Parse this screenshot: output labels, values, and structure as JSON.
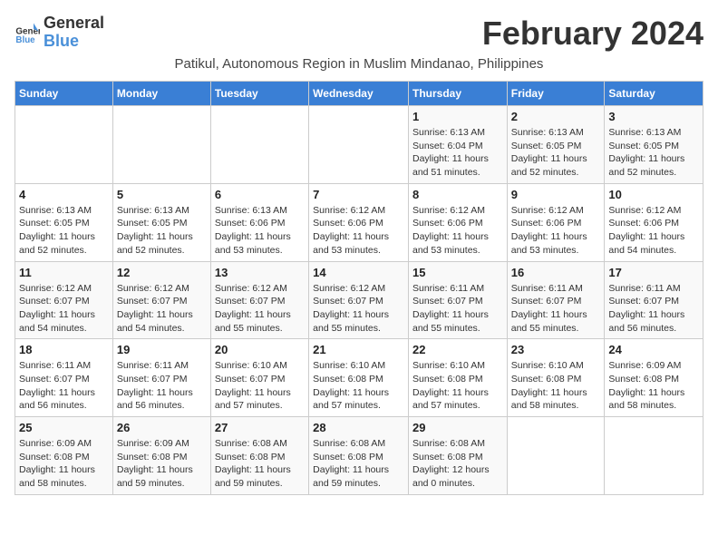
{
  "header": {
    "logo_general": "General",
    "logo_blue": "Blue",
    "month_title": "February 2024",
    "subtitle": "Patikul, Autonomous Region in Muslim Mindanao, Philippines"
  },
  "days_of_week": [
    "Sunday",
    "Monday",
    "Tuesday",
    "Wednesday",
    "Thursday",
    "Friday",
    "Saturday"
  ],
  "weeks": [
    [
      {
        "day": "",
        "sunrise": "",
        "sunset": "",
        "daylight": ""
      },
      {
        "day": "",
        "sunrise": "",
        "sunset": "",
        "daylight": ""
      },
      {
        "day": "",
        "sunrise": "",
        "sunset": "",
        "daylight": ""
      },
      {
        "day": "",
        "sunrise": "",
        "sunset": "",
        "daylight": ""
      },
      {
        "day": "1",
        "sunrise": "Sunrise: 6:13 AM",
        "sunset": "Sunset: 6:04 PM",
        "daylight": "Daylight: 11 hours and 51 minutes."
      },
      {
        "day": "2",
        "sunrise": "Sunrise: 6:13 AM",
        "sunset": "Sunset: 6:05 PM",
        "daylight": "Daylight: 11 hours and 52 minutes."
      },
      {
        "day": "3",
        "sunrise": "Sunrise: 6:13 AM",
        "sunset": "Sunset: 6:05 PM",
        "daylight": "Daylight: 11 hours and 52 minutes."
      }
    ],
    [
      {
        "day": "4",
        "sunrise": "Sunrise: 6:13 AM",
        "sunset": "Sunset: 6:05 PM",
        "daylight": "Daylight: 11 hours and 52 minutes."
      },
      {
        "day": "5",
        "sunrise": "Sunrise: 6:13 AM",
        "sunset": "Sunset: 6:05 PM",
        "daylight": "Daylight: 11 hours and 52 minutes."
      },
      {
        "day": "6",
        "sunrise": "Sunrise: 6:13 AM",
        "sunset": "Sunset: 6:06 PM",
        "daylight": "Daylight: 11 hours and 53 minutes."
      },
      {
        "day": "7",
        "sunrise": "Sunrise: 6:12 AM",
        "sunset": "Sunset: 6:06 PM",
        "daylight": "Daylight: 11 hours and 53 minutes."
      },
      {
        "day": "8",
        "sunrise": "Sunrise: 6:12 AM",
        "sunset": "Sunset: 6:06 PM",
        "daylight": "Daylight: 11 hours and 53 minutes."
      },
      {
        "day": "9",
        "sunrise": "Sunrise: 6:12 AM",
        "sunset": "Sunset: 6:06 PM",
        "daylight": "Daylight: 11 hours and 53 minutes."
      },
      {
        "day": "10",
        "sunrise": "Sunrise: 6:12 AM",
        "sunset": "Sunset: 6:06 PM",
        "daylight": "Daylight: 11 hours and 54 minutes."
      }
    ],
    [
      {
        "day": "11",
        "sunrise": "Sunrise: 6:12 AM",
        "sunset": "Sunset: 6:07 PM",
        "daylight": "Daylight: 11 hours and 54 minutes."
      },
      {
        "day": "12",
        "sunrise": "Sunrise: 6:12 AM",
        "sunset": "Sunset: 6:07 PM",
        "daylight": "Daylight: 11 hours and 54 minutes."
      },
      {
        "day": "13",
        "sunrise": "Sunrise: 6:12 AM",
        "sunset": "Sunset: 6:07 PM",
        "daylight": "Daylight: 11 hours and 55 minutes."
      },
      {
        "day": "14",
        "sunrise": "Sunrise: 6:12 AM",
        "sunset": "Sunset: 6:07 PM",
        "daylight": "Daylight: 11 hours and 55 minutes."
      },
      {
        "day": "15",
        "sunrise": "Sunrise: 6:11 AM",
        "sunset": "Sunset: 6:07 PM",
        "daylight": "Daylight: 11 hours and 55 minutes."
      },
      {
        "day": "16",
        "sunrise": "Sunrise: 6:11 AM",
        "sunset": "Sunset: 6:07 PM",
        "daylight": "Daylight: 11 hours and 55 minutes."
      },
      {
        "day": "17",
        "sunrise": "Sunrise: 6:11 AM",
        "sunset": "Sunset: 6:07 PM",
        "daylight": "Daylight: 11 hours and 56 minutes."
      }
    ],
    [
      {
        "day": "18",
        "sunrise": "Sunrise: 6:11 AM",
        "sunset": "Sunset: 6:07 PM",
        "daylight": "Daylight: 11 hours and 56 minutes."
      },
      {
        "day": "19",
        "sunrise": "Sunrise: 6:11 AM",
        "sunset": "Sunset: 6:07 PM",
        "daylight": "Daylight: 11 hours and 56 minutes."
      },
      {
        "day": "20",
        "sunrise": "Sunrise: 6:10 AM",
        "sunset": "Sunset: 6:07 PM",
        "daylight": "Daylight: 11 hours and 57 minutes."
      },
      {
        "day": "21",
        "sunrise": "Sunrise: 6:10 AM",
        "sunset": "Sunset: 6:08 PM",
        "daylight": "Daylight: 11 hours and 57 minutes."
      },
      {
        "day": "22",
        "sunrise": "Sunrise: 6:10 AM",
        "sunset": "Sunset: 6:08 PM",
        "daylight": "Daylight: 11 hours and 57 minutes."
      },
      {
        "day": "23",
        "sunrise": "Sunrise: 6:10 AM",
        "sunset": "Sunset: 6:08 PM",
        "daylight": "Daylight: 11 hours and 58 minutes."
      },
      {
        "day": "24",
        "sunrise": "Sunrise: 6:09 AM",
        "sunset": "Sunset: 6:08 PM",
        "daylight": "Daylight: 11 hours and 58 minutes."
      }
    ],
    [
      {
        "day": "25",
        "sunrise": "Sunrise: 6:09 AM",
        "sunset": "Sunset: 6:08 PM",
        "daylight": "Daylight: 11 hours and 58 minutes."
      },
      {
        "day": "26",
        "sunrise": "Sunrise: 6:09 AM",
        "sunset": "Sunset: 6:08 PM",
        "daylight": "Daylight: 11 hours and 59 minutes."
      },
      {
        "day": "27",
        "sunrise": "Sunrise: 6:08 AM",
        "sunset": "Sunset: 6:08 PM",
        "daylight": "Daylight: 11 hours and 59 minutes."
      },
      {
        "day": "28",
        "sunrise": "Sunrise: 6:08 AM",
        "sunset": "Sunset: 6:08 PM",
        "daylight": "Daylight: 11 hours and 59 minutes."
      },
      {
        "day": "29",
        "sunrise": "Sunrise: 6:08 AM",
        "sunset": "Sunset: 6:08 PM",
        "daylight": "Daylight: 12 hours and 0 minutes."
      },
      {
        "day": "",
        "sunrise": "",
        "sunset": "",
        "daylight": ""
      },
      {
        "day": "",
        "sunrise": "",
        "sunset": "",
        "daylight": ""
      }
    ]
  ]
}
